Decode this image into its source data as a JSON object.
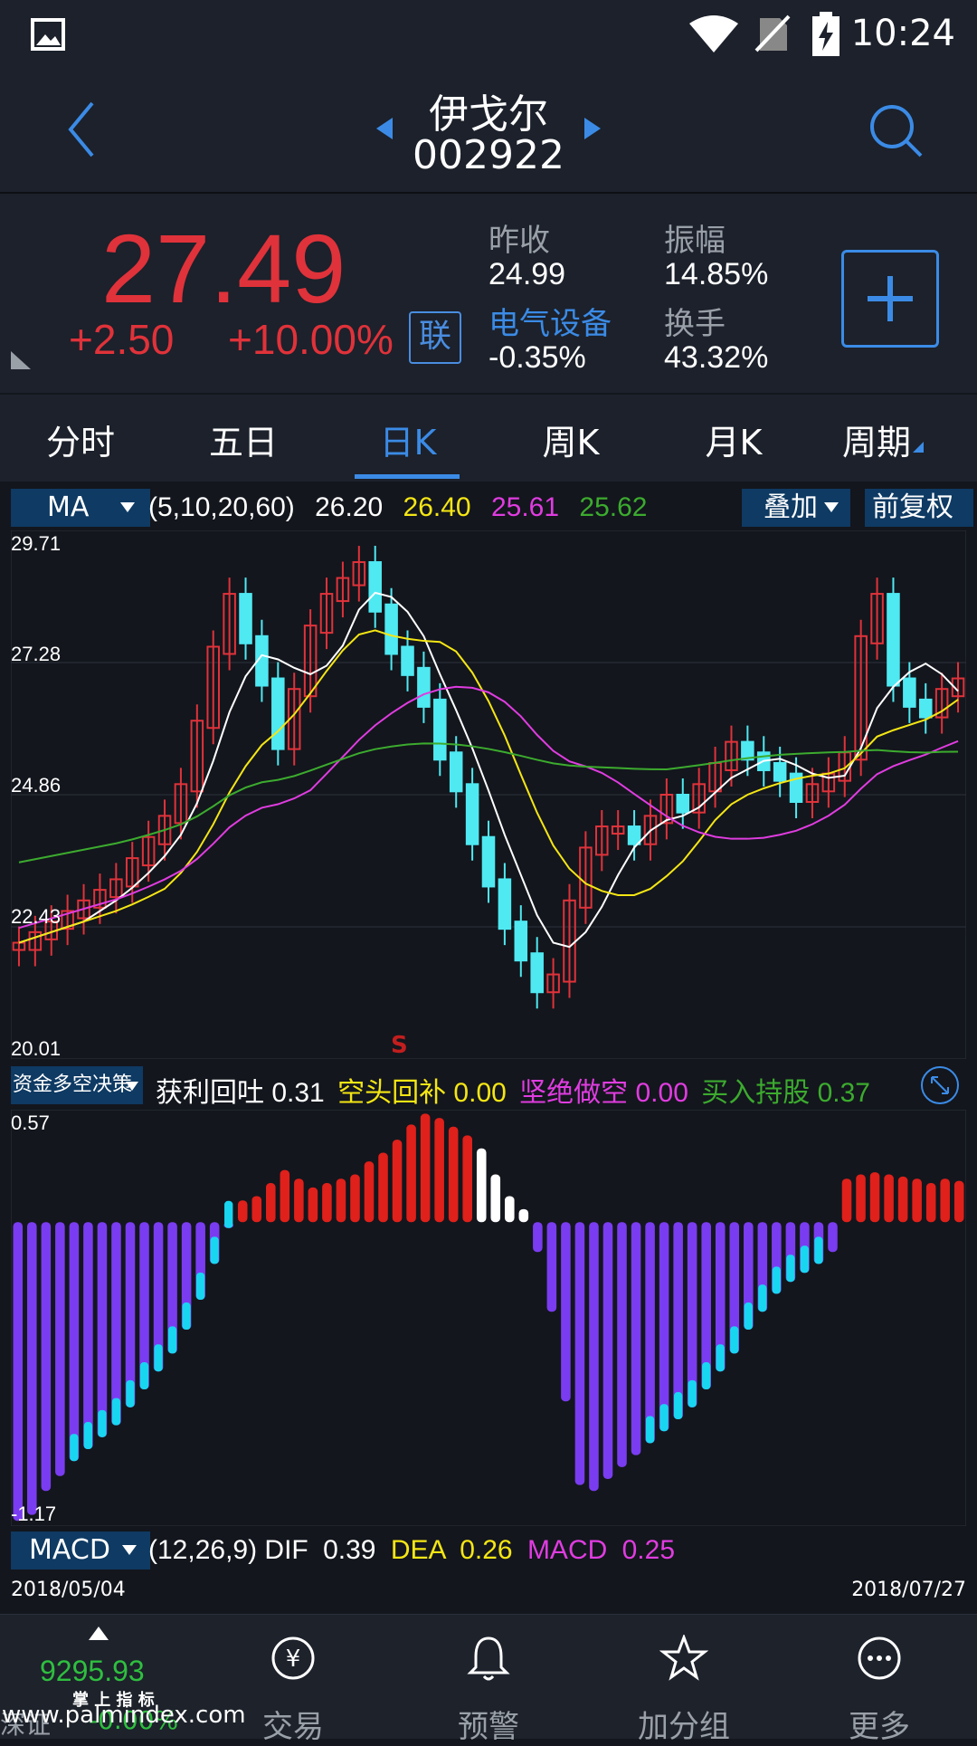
{
  "status_bar": {
    "time": "10:24"
  },
  "header": {
    "name": "伊戈尔",
    "code": "002922"
  },
  "quote": {
    "price": "27.49",
    "change": "+2.50",
    "change_pct": "+10.00%",
    "lian_label": "联",
    "prev_close_label": "昨收",
    "prev_close": "24.99",
    "amplitude_label": "振幅",
    "amplitude": "14.85%",
    "sector_label": "电气设备",
    "sector_change": "-0.35%",
    "turnover_label": "换手",
    "turnover": "43.32%"
  },
  "tabs": [
    {
      "label": "分时"
    },
    {
      "label": "五日"
    },
    {
      "label": "日K"
    },
    {
      "label": "周K"
    },
    {
      "label": "月K"
    },
    {
      "label": "周期"
    }
  ],
  "ma_bar": {
    "select": "MA",
    "params": "(5,10,20,60)",
    "v1": "26.20",
    "v2": "26.40",
    "v3": "25.61",
    "v4": "25.62",
    "overlay": "叠加",
    "adjust": "前复权"
  },
  "kline": {
    "y_labels": [
      "29.71",
      "27.28",
      "24.86",
      "22.43",
      "20.01"
    ],
    "marker": "S"
  },
  "fund_bar": {
    "select": "资金多空决策",
    "a_label": "获利回吐",
    "a_val": "0.31",
    "b_label": "空头回补",
    "b_val": "0.00",
    "c_label": "坚绝做空",
    "c_val": "0.00",
    "d_label": "买入持股",
    "d_val": "0.37",
    "y_top": "0.57",
    "y_bottom": "-1.17"
  },
  "macd_bar": {
    "select": "MACD",
    "params": "(12,26,9)",
    "dif_label": "DIF",
    "dif": "0.39",
    "dea_label": "DEA",
    "dea": "0.26",
    "macd_label": "MACD",
    "macd": "0.25"
  },
  "dates": {
    "start": "2018/05/04",
    "end": "2018/07/27"
  },
  "nav": {
    "index_value": "9295.93",
    "index_sub": "掌 上 指 标",
    "index_name": "深证",
    "index_pct": "-0.00%",
    "watermark": "www.palmindex.com",
    "items": [
      {
        "label": "交易"
      },
      {
        "label": "预警"
      },
      {
        "label": "加分组"
      },
      {
        "label": "更多"
      }
    ]
  },
  "colors": {
    "up": "#e0323a",
    "down": "#4fe9f2",
    "accent": "#3b8be6",
    "ma5": "#ffffff",
    "ma10": "#f5e614",
    "ma20": "#e03ce0",
    "ma60": "#3cab2e"
  }
}
